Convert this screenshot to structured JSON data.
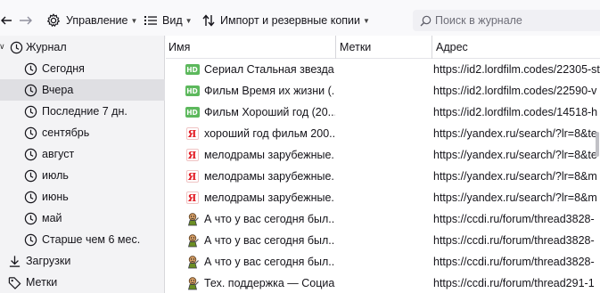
{
  "toolbar": {
    "organize_label": "Управление",
    "views_label": "Вид",
    "import_label": "Импорт и резервные копии",
    "search_placeholder": "Поиск в журнале"
  },
  "sidebar": {
    "history_label": "Журнал",
    "items": [
      {
        "label": "Сегодня"
      },
      {
        "label": "Вчера"
      },
      {
        "label": "Последние 7 дн."
      },
      {
        "label": "сентябрь"
      },
      {
        "label": "август"
      },
      {
        "label": "июль"
      },
      {
        "label": "июнь"
      },
      {
        "label": "май"
      },
      {
        "label": "Старше чем 6 мес."
      }
    ],
    "downloads_label": "Загрузки",
    "tags_label": "Метки",
    "selected_index": 1
  },
  "table": {
    "columns": {
      "name": "Имя",
      "tags": "Метки",
      "url": "Адрес"
    },
    "rows": [
      {
        "icon": "hd-favicon",
        "name": "Сериал Стальная звезда ...",
        "url": "https://id2.lordfilm.codes/22305-st"
      },
      {
        "icon": "hd-favicon",
        "name": "Фильм Время их жизни (...",
        "url": "https://id2.lordfilm.codes/22590-v"
      },
      {
        "icon": "hd-favicon",
        "name": "Фильм Хороший год (20...",
        "url": "https://id2.lordfilm.codes/14518-h"
      },
      {
        "icon": "yandex-favicon",
        "name": "хороший год фильм 200...",
        "url": "https://yandex.ru/search/?lr=8&te"
      },
      {
        "icon": "yandex-favicon",
        "name": "мелодрамы зарубежные...",
        "url": "https://yandex.ru/search/?lr=8&te"
      },
      {
        "icon": "yandex-favicon",
        "name": "мелодрамы зарубежные...",
        "url": "https://yandex.ru/search/?lr=8&m"
      },
      {
        "icon": "yandex-favicon",
        "name": "мелодрамы зарубежные...",
        "url": "https://yandex.ru/search/?lr=8&m"
      },
      {
        "icon": "ccdi-favicon",
        "name": "А что у вас сегодня был...",
        "url": "https://ccdi.ru/forum/thread3828-"
      },
      {
        "icon": "ccdi-favicon",
        "name": "А что у вас сегодня был...",
        "url": "https://ccdi.ru/forum/thread3828-"
      },
      {
        "icon": "ccdi-favicon",
        "name": "А что у вас сегодня был...",
        "url": "https://ccdi.ru/forum/thread3828-"
      },
      {
        "icon": "ccdi-favicon",
        "name": "Тех. поддержка — Социа...",
        "url": "https://ccdi.ru/forum/thread291-1"
      }
    ]
  },
  "colors": {
    "toolbar_bg": "#f9f9fb",
    "sidebar_bg": "#f3f3f5",
    "selection_bg": "#dfdfe3",
    "hd_badge": "#5cb85c",
    "yandex_red": "#e31b23"
  }
}
